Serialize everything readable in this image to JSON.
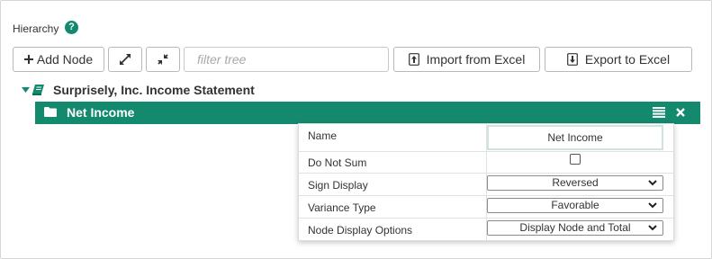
{
  "hierarchy": {
    "label": "Hierarchy",
    "help_glyph": "?"
  },
  "toolbar": {
    "add_node_label": "Add Node",
    "filter_placeholder": "filter tree",
    "import_label": "Import from Excel",
    "export_label": "Export to Excel"
  },
  "tree": {
    "root_label": "Surprisely, Inc. Income Statement",
    "selected_node_label": "Net Income"
  },
  "properties": {
    "name_label": "Name",
    "name_value": "Net Income",
    "do_not_sum_label": "Do Not Sum",
    "do_not_sum_checked": false,
    "sign_display_label": "Sign Display",
    "sign_display_value": "Reversed",
    "variance_type_label": "Variance Type",
    "variance_type_value": "Favorable",
    "node_display_label": "Node Display Options",
    "node_display_value": "Display Node and Total"
  },
  "colors": {
    "accent": "#138a6e",
    "border": "#b9b9b9",
    "text": "#333333"
  },
  "icons": {
    "help": "question-circle-icon",
    "add": "plus-icon",
    "expand": "expand-arrows-icon",
    "collapse": "compress-arrows-icon",
    "import": "upload-icon",
    "export": "download-icon",
    "caret": "caret-down-icon",
    "book": "book-icon",
    "folder": "folder-icon",
    "menu": "list-icon",
    "close": "close-icon"
  }
}
